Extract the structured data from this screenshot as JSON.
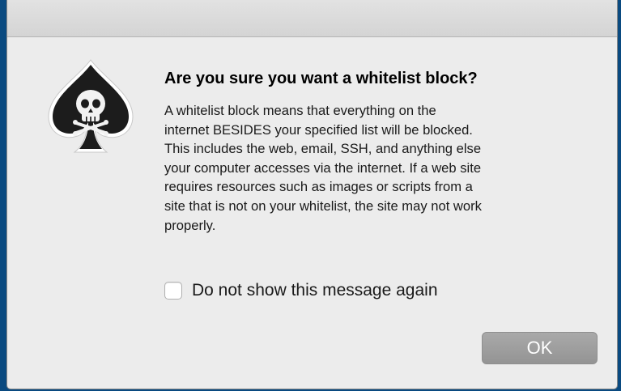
{
  "dialog": {
    "title": "Are you sure you want a whitelist block?",
    "icon": "spade-skull-icon",
    "message_lines": [
      "A whitelist block means that everything on the",
      "internet BESIDES your specified list will be blocked.",
      "This includes the web, email, SSH, and anything else",
      "your computer accesses via the internet.  If a web site",
      "requires resources such as images or scripts from a",
      "site that is not on your whitelist, the site may not work",
      "properly."
    ],
    "checkbox": {
      "label": "Do not show this message again",
      "checked": false
    },
    "ok_label": "OK"
  },
  "colors": {
    "desktop_background": "#0a4a80",
    "dialog_background": "#ececec",
    "button_background": "#9e9e9e",
    "icon_fill": "#1c1c1c"
  }
}
